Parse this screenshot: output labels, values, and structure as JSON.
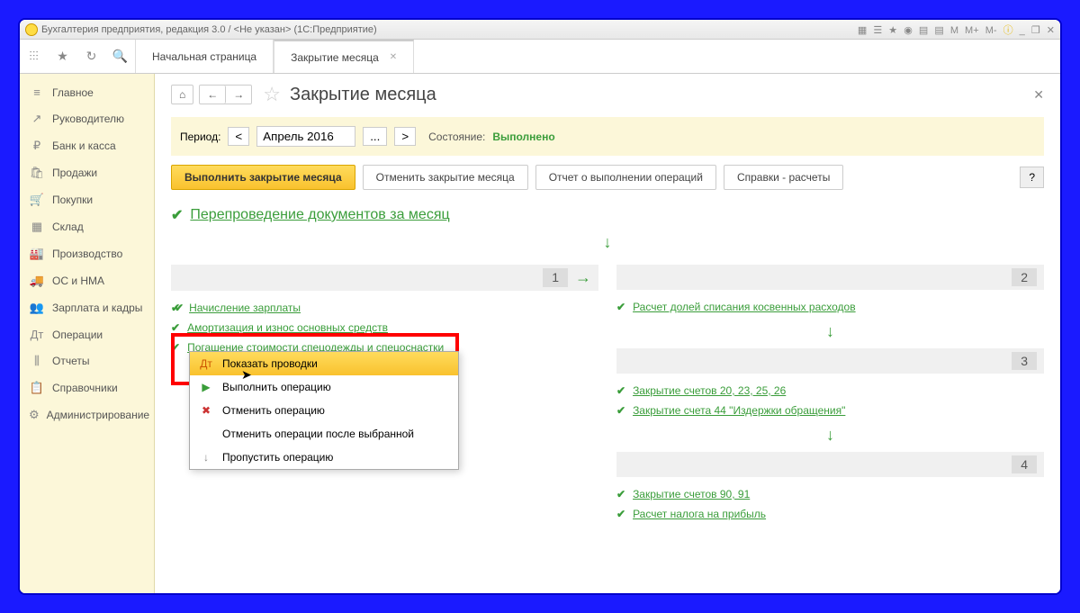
{
  "titlebar": {
    "text": "Бухгалтерия предприятия, редакция 3.0 / <Не указан> (1С:Предприятие)"
  },
  "tabs": {
    "home": "Начальная страница",
    "active": "Закрытие месяца"
  },
  "sidebar": {
    "items": [
      {
        "icon": "≡",
        "label": "Главное"
      },
      {
        "icon": "↗",
        "label": "Руководителю"
      },
      {
        "icon": "₽",
        "label": "Банк и касса"
      },
      {
        "icon": "🛍",
        "label": "Продажи"
      },
      {
        "icon": "🛒",
        "label": "Покупки"
      },
      {
        "icon": "▦",
        "label": "Склад"
      },
      {
        "icon": "🏭",
        "label": "Производство"
      },
      {
        "icon": "🚚",
        "label": "ОС и НМА"
      },
      {
        "icon": "👥",
        "label": "Зарплата и кадры"
      },
      {
        "icon": "Дт",
        "label": "Операции"
      },
      {
        "icon": "⫼",
        "label": "Отчеты"
      },
      {
        "icon": "📋",
        "label": "Справочники"
      },
      {
        "icon": "⚙",
        "label": "Администрирование"
      }
    ]
  },
  "header": {
    "title": "Закрытие месяца"
  },
  "period": {
    "label": "Период:",
    "value": "Апрель 2016",
    "status_label": "Состояние:",
    "status_value": "Выполнено"
  },
  "actions": {
    "primary": "Выполнить закрытие месяца",
    "cancel": "Отменить закрытие месяца",
    "report": "Отчет о выполнении операций",
    "refs": "Справки - расчеты",
    "help": "?"
  },
  "top_op": "Перепроведение документов за месяц",
  "col1": {
    "items": [
      "Начисление зарплаты",
      "Амортизация и износ основных средств",
      "Погашение стоимости спецодежды и спецоснастки"
    ]
  },
  "col2": {
    "sec2": "Расчет долей списания косвенных расходов",
    "sec3a": "Закрытие счетов 20, 23, 25, 26",
    "sec3b": "Закрытие счета 44 \"Издержки обращения\"",
    "sec4a": "Закрытие счетов 90, 91",
    "sec4b": "Расчет налога на прибыль"
  },
  "context": {
    "items": [
      {
        "icon": "Дт",
        "label": "Показать проводки"
      },
      {
        "icon": "▶",
        "label": "Выполнить операцию"
      },
      {
        "icon": "✖",
        "label": "Отменить операцию"
      },
      {
        "icon": "",
        "label": "Отменить операции после выбранной"
      },
      {
        "icon": "↓",
        "label": "Пропустить операцию"
      }
    ]
  },
  "section_nums": {
    "s1": "1",
    "s2": "2",
    "s3": "3",
    "s4": "4"
  }
}
